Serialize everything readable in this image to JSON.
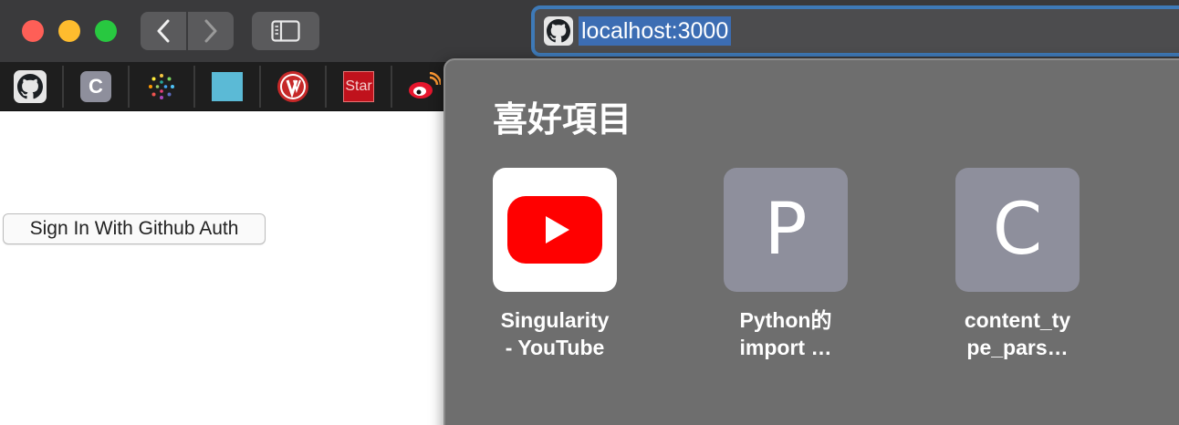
{
  "toolbar": {
    "url": "localhost:3000"
  },
  "bookmarks": [
    {
      "icon": "github-icon",
      "label": ""
    },
    {
      "icon": "letter-c-icon",
      "label": "C"
    },
    {
      "icon": "dots-circle-icon",
      "label": ""
    },
    {
      "icon": "blue-square-icon",
      "label": ""
    },
    {
      "icon": "red-v-icon",
      "label": ""
    },
    {
      "icon": "star-icon",
      "label": "Star"
    },
    {
      "icon": "weibo-icon",
      "label": ""
    }
  ],
  "page": {
    "signin_label": "Sign In With Github Auth"
  },
  "favorites": {
    "title": "喜好項目",
    "items": [
      {
        "icon": "youtube-icon",
        "line1": "Singularity",
        "line2": "- YouTube"
      },
      {
        "letter": "P",
        "line1": "Python的",
        "line2": "import …"
      },
      {
        "letter": "C",
        "line1": "content_ty",
        "line2": "pe_pars…"
      }
    ]
  },
  "colors": {
    "accent": "#3e7ab8",
    "close": "#fe5f57",
    "minimize": "#febc2e",
    "maximize": "#28c840"
  }
}
